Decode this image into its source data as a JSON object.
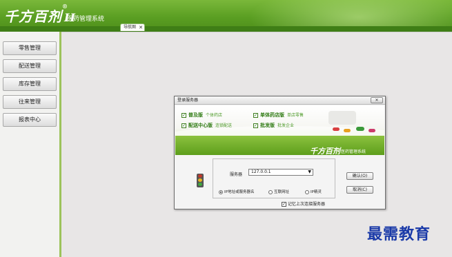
{
  "app": {
    "logo_text": "千方百剂",
    "logo_version": "II",
    "logo_reg": "®",
    "title": "医药管理系统"
  },
  "tab": {
    "label": "导航图",
    "close": "✕"
  },
  "sidebar": {
    "items": [
      {
        "label": "零售管理"
      },
      {
        "label": "配送管理"
      },
      {
        "label": "库存管理"
      },
      {
        "label": "往来管理"
      },
      {
        "label": "报表中心"
      }
    ]
  },
  "dialog": {
    "title": "登录服务器",
    "close_label": "✕",
    "features": [
      {
        "name": "普及版",
        "sub": "个体药店",
        "checked": true
      },
      {
        "name": "单体药店版",
        "sub": "单店零售",
        "checked": true
      },
      {
        "name": "配送中心版",
        "sub": "连锁配送",
        "checked": true
      },
      {
        "name": "批发版",
        "sub": "批发企业",
        "checked": true
      }
    ],
    "banner_logo": "千方百剂",
    "banner_subtitle": "医药管理系统",
    "server_label": "服务器",
    "server_value": "127.0.0.1",
    "radios": [
      {
        "label": "IP地址或服务器名",
        "selected": true
      },
      {
        "label": "互联网址",
        "selected": false
      },
      {
        "label": "IP精灵",
        "selected": false
      }
    ],
    "ok_button": "确认(O)",
    "cancel_button": "取消(C)",
    "remember_label": "记忆上次连接服务器",
    "remember_checked": true
  },
  "watermark": "最需教育",
  "colors": {
    "banner_green": "#5a9e22",
    "sidebar_accent": "#9cc35a",
    "watermark_blue": "#1a3aa8"
  }
}
